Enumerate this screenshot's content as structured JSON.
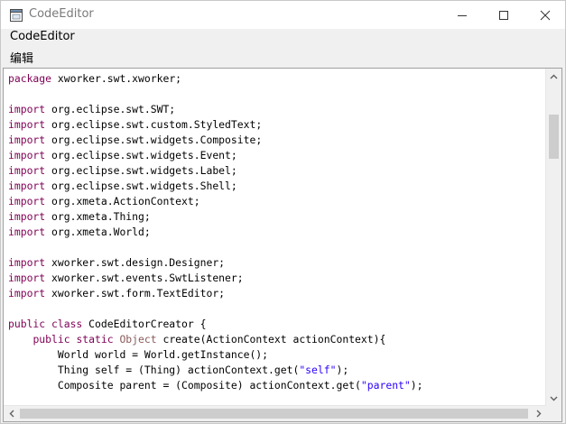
{
  "window": {
    "title": "CodeEditor",
    "app_icon": "window-app-icon",
    "controls": [
      "minimize-icon",
      "maximize-icon",
      "close-icon"
    ]
  },
  "menubar": {
    "items": [
      "CodeEditor"
    ],
    "submenu_label": "编辑"
  },
  "editor": {
    "lines": [
      {
        "segs": [
          {
            "t": "package",
            "c": "kw"
          },
          {
            "t": " xworker.swt.xworker;",
            "c": ""
          }
        ]
      },
      {
        "segs": []
      },
      {
        "segs": [
          {
            "t": "import",
            "c": "kw"
          },
          {
            "t": " org.eclipse.swt.SWT;",
            "c": ""
          }
        ]
      },
      {
        "segs": [
          {
            "t": "import",
            "c": "kw"
          },
          {
            "t": " org.eclipse.swt.custom.StyledText;",
            "c": ""
          }
        ]
      },
      {
        "segs": [
          {
            "t": "import",
            "c": "kw"
          },
          {
            "t": " org.eclipse.swt.widgets.Composite;",
            "c": ""
          }
        ]
      },
      {
        "segs": [
          {
            "t": "import",
            "c": "kw"
          },
          {
            "t": " org.eclipse.swt.widgets.Event;",
            "c": ""
          }
        ]
      },
      {
        "segs": [
          {
            "t": "import",
            "c": "kw"
          },
          {
            "t": " org.eclipse.swt.widgets.Label;",
            "c": ""
          }
        ]
      },
      {
        "segs": [
          {
            "t": "import",
            "c": "kw"
          },
          {
            "t": " org.eclipse.swt.widgets.Shell;",
            "c": ""
          }
        ]
      },
      {
        "segs": [
          {
            "t": "import",
            "c": "kw"
          },
          {
            "t": " org.xmeta.ActionContext;",
            "c": ""
          }
        ]
      },
      {
        "segs": [
          {
            "t": "import",
            "c": "kw"
          },
          {
            "t": " org.xmeta.Thing;",
            "c": ""
          }
        ]
      },
      {
        "segs": [
          {
            "t": "import",
            "c": "kw"
          },
          {
            "t": " org.xmeta.World;",
            "c": ""
          }
        ]
      },
      {
        "segs": []
      },
      {
        "segs": [
          {
            "t": "import",
            "c": "kw"
          },
          {
            "t": " xworker.swt.design.Designer;",
            "c": ""
          }
        ]
      },
      {
        "segs": [
          {
            "t": "import",
            "c": "kw"
          },
          {
            "t": " xworker.swt.events.SwtListener;",
            "c": ""
          }
        ]
      },
      {
        "segs": [
          {
            "t": "import",
            "c": "kw"
          },
          {
            "t": " xworker.swt.form.TextEditor;",
            "c": ""
          }
        ]
      },
      {
        "segs": []
      },
      {
        "segs": [
          {
            "t": "public class",
            "c": "kw"
          },
          {
            "t": " CodeEditorCreator {",
            "c": ""
          }
        ]
      },
      {
        "segs": [
          {
            "t": "    ",
            "c": ""
          },
          {
            "t": "public static",
            "c": "kw"
          },
          {
            "t": " ",
            "c": ""
          },
          {
            "t": "Object",
            "c": "ty"
          },
          {
            "t": " create(ActionContext actionContext){",
            "c": ""
          }
        ]
      },
      {
        "segs": [
          {
            "t": "        World world = World.getInstance();",
            "c": ""
          }
        ]
      },
      {
        "segs": [
          {
            "t": "        Thing self = (Thing) actionContext.get(",
            "c": ""
          },
          {
            "t": "\"self\"",
            "c": "str"
          },
          {
            "t": ");",
            "c": ""
          }
        ]
      },
      {
        "segs": [
          {
            "t": "        Composite parent = (Composite) actionContext.get(",
            "c": ""
          },
          {
            "t": "\"parent\"",
            "c": "str"
          },
          {
            "t": ");",
            "c": ""
          }
        ]
      }
    ]
  },
  "scrollbars": {
    "vertical_icons": [
      "scroll-up-icon",
      "scroll-down-icon"
    ],
    "horizontal_icons": [
      "scroll-left-icon",
      "scroll-right-icon"
    ]
  }
}
